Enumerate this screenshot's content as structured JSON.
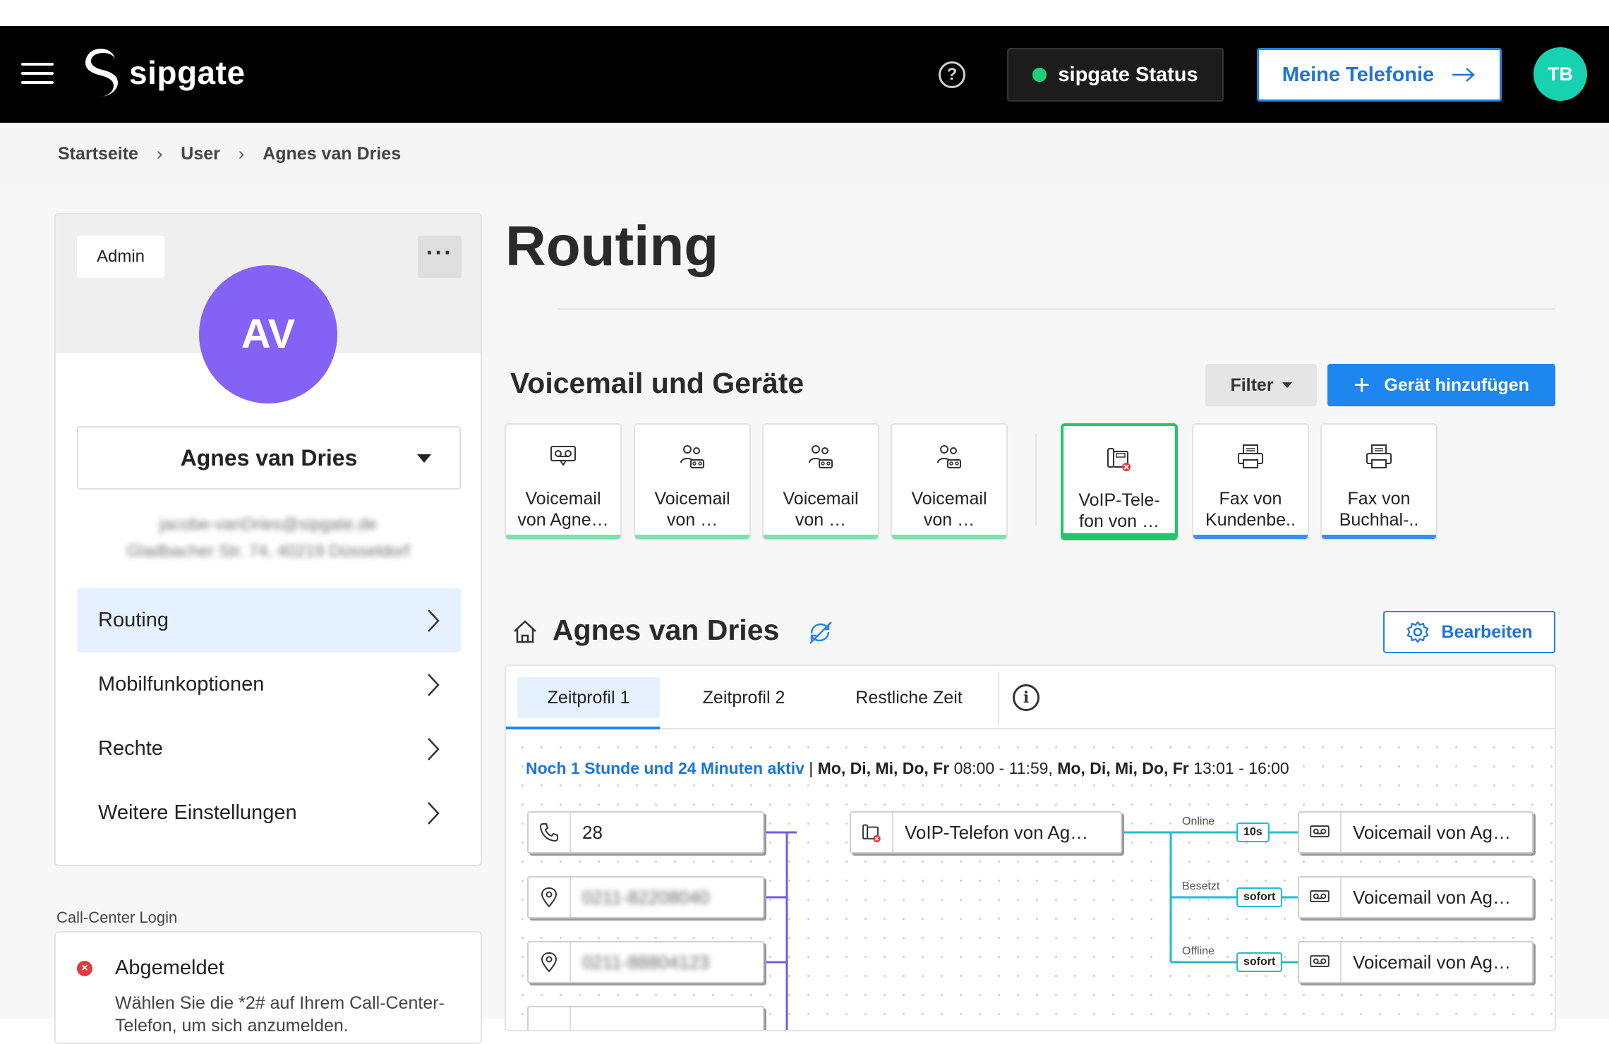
{
  "header": {
    "brand": "sipgate",
    "help_label": "?",
    "status_label": "sipgate Status",
    "status_color": "#1ed07a",
    "cta_label": "Meine Telefonie",
    "user_initials": "TB"
  },
  "breadcrumb": [
    "Startseite",
    "User",
    "Agnes van Dries"
  ],
  "user_card": {
    "role_badge": "Admin",
    "more_label": "···",
    "initials": "AV",
    "avatar_color": "#8462f5",
    "selected_user": "Agnes van Dries",
    "email_blurred": "jacobe-vanDries@sipgate.de",
    "address_blurred": "Gladbacher Str. 74, 40219 Düsseldorf",
    "nav": [
      {
        "label": "Routing",
        "active": true
      },
      {
        "label": "Mobilfunkoptionen",
        "active": false
      },
      {
        "label": "Rechte",
        "active": false
      },
      {
        "label": "Weitere Einstellungen",
        "active": false
      }
    ]
  },
  "call_center": {
    "section_label": "Call-Center Login",
    "state": "Abgemeldet",
    "hint": "Wählen Sie die *2# auf Ihrem Call-Center-Telefon, um sich anzumelden."
  },
  "main": {
    "title": "Routing",
    "devices_title": "Voicemail und Geräte",
    "filter_label": "Filter",
    "add_label": "Gerät hinzufügen",
    "devices": [
      {
        "line1": "Voicemail",
        "line2": "von Agne…",
        "icon": "voicemail-icon",
        "bar_color": "#7fe0a8",
        "selected": false
      },
      {
        "line1": "Voicemail",
        "line2": "von …",
        "icon": "group-voicemail-icon",
        "bar_color": "#7fe0a8",
        "selected": false
      },
      {
        "line1": "Voicemail",
        "line2": "von …",
        "icon": "group-voicemail-icon",
        "bar_color": "#7fe0a8",
        "selected": false
      },
      {
        "line1": "Voicemail",
        "line2": "von …",
        "icon": "group-voicemail-icon",
        "bar_color": "#7fe0a8",
        "selected": false
      },
      {
        "line1": "VoIP-Tele-",
        "line2": "fon von …",
        "icon": "voip-phone-offline-icon",
        "bar_color": "#22c66a",
        "selected": true
      },
      {
        "line1": "Fax von",
        "line2": "Kundenbe..",
        "icon": "fax-icon",
        "bar_color": "#3d8ef0",
        "selected": false
      },
      {
        "line1": "Fax von",
        "line2": "Buchhal-..",
        "icon": "fax-icon",
        "bar_color": "#3d8ef0",
        "selected": false
      }
    ]
  },
  "routing": {
    "title": "Agnes van Dries",
    "edit_label": "Bearbeiten",
    "tabs": [
      "Zeitprofil 1",
      "Zeitprofil 2",
      "Restliche Zeit"
    ],
    "active_tab": "Zeitprofil 1",
    "info_label": "i",
    "active_text": "Noch 1 Stunde und 24 Minuten aktiv",
    "schedule_sep": "|",
    "schedule_days_1": "Mo, Di, Mi, Do, Fr",
    "schedule_time_1": "08:00 - 11:59,",
    "schedule_days_2": "Mo, Di, Mi, Do, Fr",
    "schedule_time_2": "13:01 - 16:00",
    "sources": [
      {
        "icon": "phone-extension-icon",
        "text": "28",
        "blurred": false
      },
      {
        "icon": "location-pin-icon",
        "text": "0211-82208040",
        "blurred": true
      },
      {
        "icon": "location-pin-icon",
        "text": "0211-88804123",
        "blurred": true
      }
    ],
    "device_node": "VoIP-Telefon von Ag…",
    "branches": [
      {
        "condition": "Online",
        "delay": "10s",
        "target": "Voicemail von Ag…"
      },
      {
        "condition": "Besetzt",
        "delay": "sofort",
        "target": "Voicemail von Ag…"
      },
      {
        "condition": "Offline",
        "delay": "sofort",
        "target": "Voicemail von Ag…"
      }
    ],
    "line_colors": {
      "inbound": "#6b5cf0",
      "outbound": "#1fbcd4"
    }
  }
}
